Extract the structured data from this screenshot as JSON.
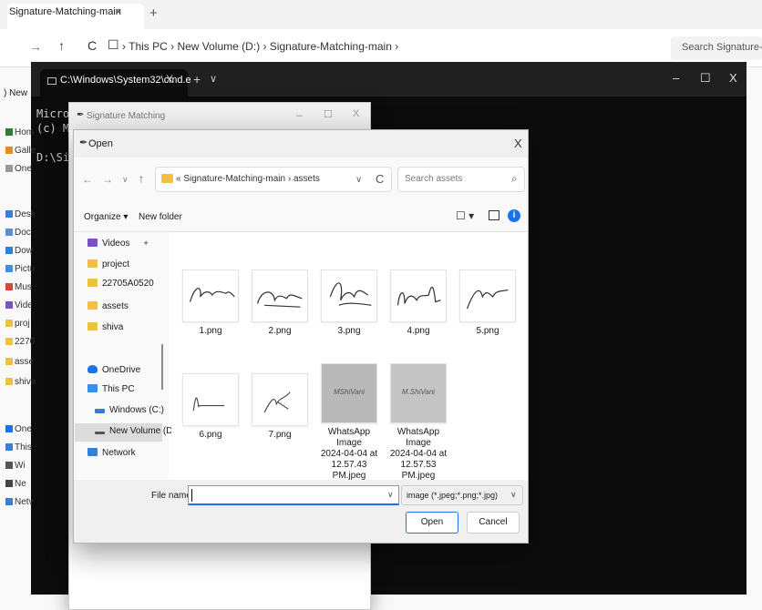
{
  "explorer": {
    "tab_title": "Signature-Matching-main",
    "tab_close": "×",
    "new_tab": "+",
    "nav": {
      "back": "→",
      "up": "↑",
      "refresh": "C",
      "monitor": "☐"
    },
    "breadcrumb": "›  This PC  ›  New Volume (D:)  ›  Signature-Matching-main  ›",
    "search_placeholder": "Search Signature-Ma",
    "new_label": ") New",
    "sidebar": [
      "Hom",
      "Galle",
      "One",
      "Desk",
      "Doc",
      "Dow",
      "Pictu",
      "Mus",
      "Vide",
      "proj",
      "2270",
      "asse",
      "shiva",
      "One",
      "This",
      "Wi",
      "Ne",
      "Netv"
    ]
  },
  "cmd": {
    "tab_title": "C:\\Windows\\System32\\cmd.e",
    "tab_close": "X",
    "new_tab": "+",
    "dropdown": "∨",
    "minimize": "–",
    "maximize": "☐",
    "close": "X",
    "lines": [
      "Micros",
      "(c) Mi",
      "D:\\Sig"
    ]
  },
  "sig_window": {
    "title": "Signature Matching",
    "minimize": "–",
    "maximize": "☐",
    "close": "X"
  },
  "dialog": {
    "title": "Open",
    "close": "X",
    "nav": {
      "back": "←",
      "forward": "→",
      "dropdown": "∨",
      "up": "↑"
    },
    "address": "« Signature-Matching-main  ›  assets",
    "address_chevron": "∨",
    "refresh": "C",
    "search_placeholder": "Search assets",
    "search_icon": "⌕",
    "toolbar": {
      "organize": "Organize ▾",
      "new_folder": "New folder",
      "view": "☐ ▾",
      "help": "i"
    },
    "nav_items": [
      {
        "label": "Videos",
        "icon": "videos",
        "pin": "✦"
      },
      {
        "label": "project",
        "icon": "folder"
      },
      {
        "label": "22705A0520",
        "icon": "folder"
      },
      {
        "label": "assets",
        "icon": "folder"
      },
      {
        "label": "shiva",
        "icon": "folder"
      },
      {
        "label": "OneDrive",
        "icon": "cloud"
      },
      {
        "label": "This PC",
        "icon": "pc"
      },
      {
        "label": "Windows (C:)",
        "icon": "drive"
      },
      {
        "label": "New Volume (D:",
        "icon": "drive-d"
      },
      {
        "label": "Network",
        "icon": "network"
      }
    ],
    "files": [
      {
        "name": "1.png"
      },
      {
        "name": "2.png"
      },
      {
        "name": "3.png"
      },
      {
        "name": "4.png"
      },
      {
        "name": "5.png"
      },
      {
        "name": "6.png"
      },
      {
        "name": "7.png"
      },
      {
        "name": "WhatsApp Image 2024-04-04 at 12.57.43 PM.jpeg",
        "lines": [
          "WhatsApp Image",
          "2024-04-04 at",
          "12.57.43 PM.jpeg"
        ]
      },
      {
        "name": "WhatsApp Image 2024-04-04 at 12.57.53 PM.jpeg",
        "lines": [
          "WhatsApp Image",
          "2024-04-04 at",
          "12.57.53 PM.jpeg"
        ]
      }
    ],
    "photo_captions": [
      "MShiVani",
      "M.ShiVani"
    ],
    "file_name_label": "File name:",
    "file_name_value": "",
    "file_name_chevron": "∨",
    "filter": "image (*.jpeg;*.png;*.jpg)",
    "filter_chevron": "∨",
    "open_label": "Open",
    "cancel_label": "Cancel"
  },
  "colors": {
    "accent": "#1a73e8",
    "folder": "#f0c040",
    "cmd_bg": "#0c0c0c"
  }
}
